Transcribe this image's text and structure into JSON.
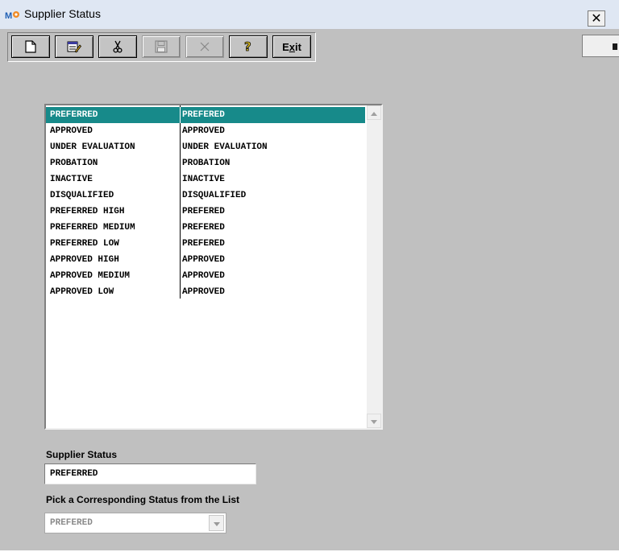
{
  "window": {
    "title": "Supplier Status",
    "close_label": "✕",
    "icon": "app-logo-icon"
  },
  "toolbar": {
    "buttons": [
      {
        "name": "new-document",
        "icon": "new-document-icon",
        "enabled": true
      },
      {
        "name": "edit",
        "icon": "edit-icon",
        "enabled": true
      },
      {
        "name": "cut",
        "icon": "scissors-icon",
        "enabled": true
      },
      {
        "name": "save",
        "icon": "floppy-disk-icon",
        "enabled": false
      },
      {
        "name": "delete",
        "icon": "x-icon",
        "enabled": false
      },
      {
        "name": "help",
        "icon": "question-mark-icon",
        "enabled": true
      }
    ],
    "exit_label_prefix": "E",
    "exit_label_underline": "x",
    "exit_label_suffix": "it"
  },
  "list": {
    "selected_index": 0,
    "rows": [
      {
        "status": "PREFERRED",
        "corresponding": "PREFERED"
      },
      {
        "status": "APPROVED",
        "corresponding": "APPROVED"
      },
      {
        "status": "UNDER EVALUATION",
        "corresponding": "UNDER EVALUATION"
      },
      {
        "status": "PROBATION",
        "corresponding": "PROBATION"
      },
      {
        "status": "INACTIVE",
        "corresponding": "INACTIVE"
      },
      {
        "status": "DISQUALIFIED",
        "corresponding": "DISQUALIFIED"
      },
      {
        "status": "PREFERRED HIGH",
        "corresponding": "PREFERED"
      },
      {
        "status": "PREFERRED MEDIUM",
        "corresponding": "PREFERED"
      },
      {
        "status": "PREFERRED LOW",
        "corresponding": "PREFERED"
      },
      {
        "status": "APPROVED HIGH",
        "corresponding": "APPROVED"
      },
      {
        "status": "APPROVED MEDIUM",
        "corresponding": "APPROVED"
      },
      {
        "status": "APPROVED LOW",
        "corresponding": "APPROVED"
      }
    ]
  },
  "form": {
    "supplier_status_label": "Supplier Status",
    "supplier_status_value": "PREFERRED",
    "corresponding_label": "Pick a Corresponding Status from the List",
    "corresponding_value": "PREFERED"
  },
  "colors": {
    "selection": "#178a8a",
    "window_bg": "#c0c0c0"
  }
}
